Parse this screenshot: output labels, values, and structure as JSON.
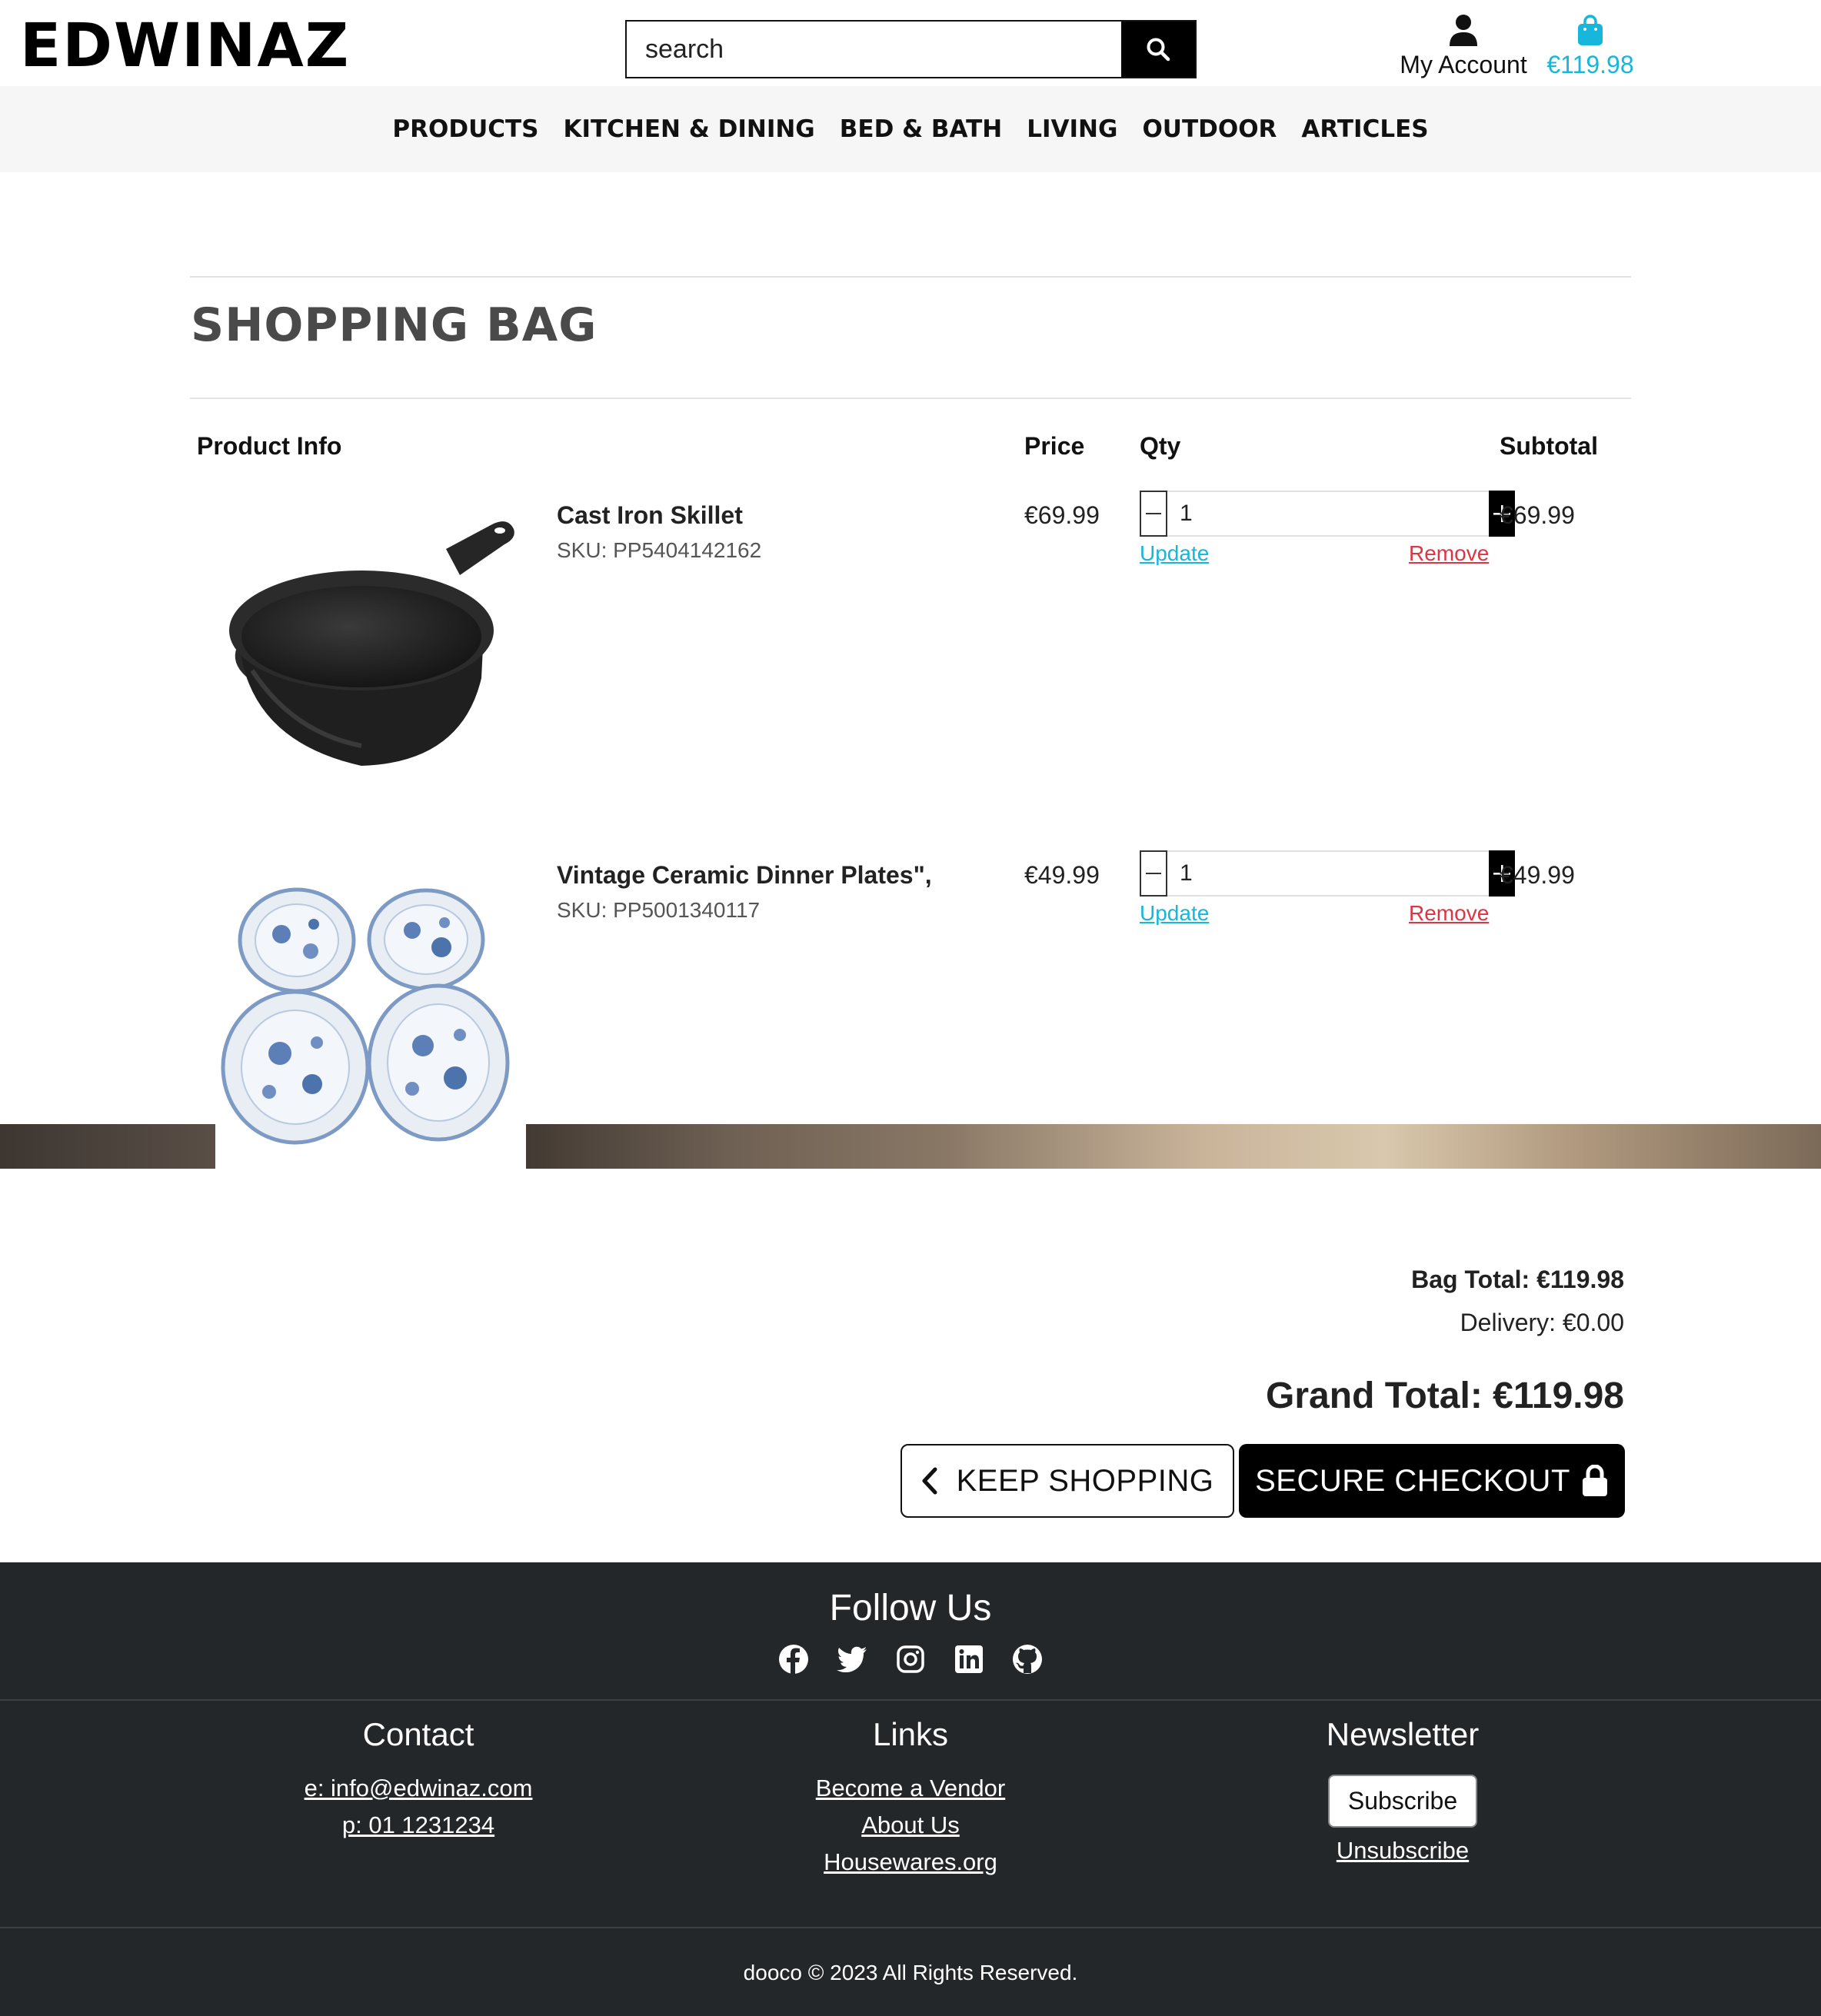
{
  "header": {
    "logo": "EDWINAZ",
    "search": {
      "placeholder": "search",
      "value": ""
    },
    "account_label": "My Account",
    "bag_total": "€119.98"
  },
  "nav": [
    "PRODUCTS",
    "KITCHEN & DINING",
    "BED & BATH",
    "LIVING",
    "OUTDOOR",
    "ARTICLES"
  ],
  "page_title": "SHOPPING BAG",
  "table": {
    "headers": {
      "info": "Product Info",
      "price": "Price",
      "qty": "Qty",
      "subtotal": "Subtotal"
    },
    "items": [
      {
        "name": "Cast Iron Skillet",
        "sku": "SKU: PP5404142162",
        "price": "€69.99",
        "qty": "1",
        "subtotal": "€69.99",
        "update": "Update",
        "remove": "Remove"
      },
      {
        "name": "Vintage Ceramic Dinner Plates\",",
        "sku": "SKU: PP5001340117",
        "price": "€49.99",
        "qty": "1",
        "subtotal": "€49.99",
        "update": "Update",
        "remove": "Remove"
      }
    ]
  },
  "totals": {
    "bag_total": "Bag Total: €119.98",
    "delivery": "Delivery: €0.00",
    "grand_total": "Grand Total: €119.98"
  },
  "buttons": {
    "keep_shopping": "KEEP SHOPPING",
    "checkout": "SECURE CHECKOUT"
  },
  "icons": {
    "search": "search-icon",
    "account": "user-icon",
    "bag": "shopping-bag-icon",
    "back": "chevron-left-icon",
    "lock": "lock-icon",
    "socials": [
      "facebook-icon",
      "twitter-icon",
      "instagram-icon",
      "linkedin-icon",
      "github-icon"
    ]
  },
  "colors": {
    "accent": "#17b6dc",
    "remove": "#dc3545",
    "footer_bg": "#232729",
    "nav_bg": "#f6f6f6"
  },
  "footer": {
    "follow": "Follow Us",
    "contact": {
      "title": "Contact",
      "email": "e: info@edwinaz.com",
      "phone": "p: 01 1231234"
    },
    "links": {
      "title": "Links",
      "items": [
        "Become a Vendor",
        "About Us",
        "Housewares.org"
      ]
    },
    "newsletter": {
      "title": "Newsletter",
      "subscribe": "Subscribe",
      "unsubscribe": "Unsubscribe"
    },
    "copyright": "dooco © 2023 All Rights Reserved."
  }
}
